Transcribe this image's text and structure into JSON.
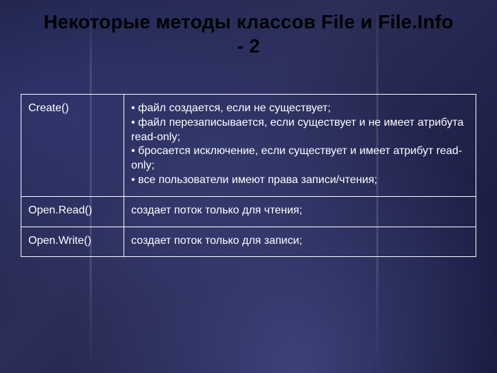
{
  "title": "Некоторые методы классов File и File.Info\n- 2",
  "table": {
    "rows": [
      {
        "method": "Create()",
        "description": "• файл создается, если не существует;\n• файл перезаписывается, если существует и не имеет атрибута read-only;\n• бросается исключение, если существует и имеет атрибут read-only;\n• все пользователи имеют права записи/чтения;"
      },
      {
        "method": "Open.Read()",
        "description": "создает поток только для чтения;"
      },
      {
        "method": "Open.Write()",
        "description": "создает поток только для записи;"
      }
    ]
  }
}
